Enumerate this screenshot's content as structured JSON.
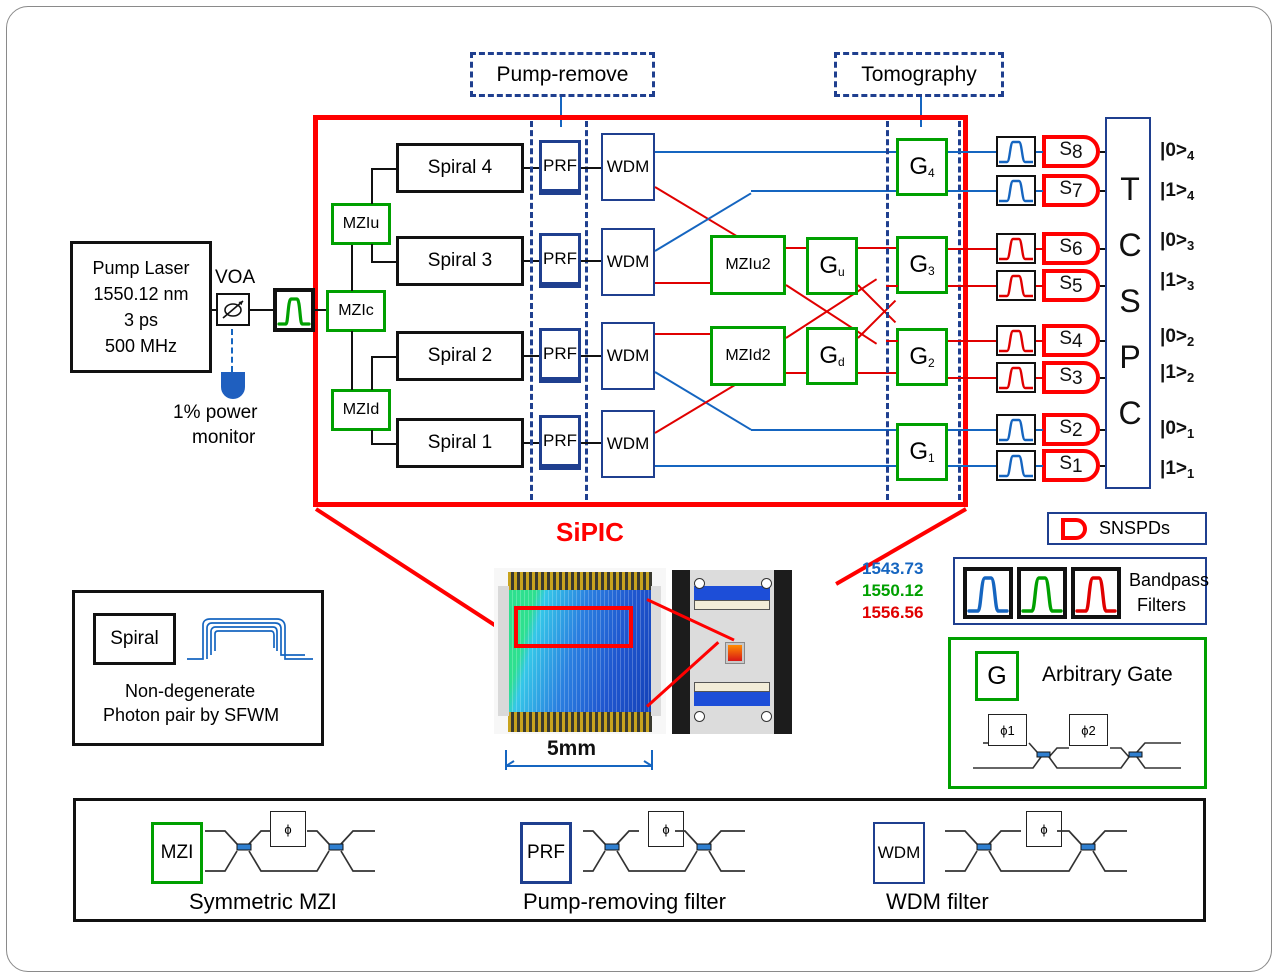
{
  "figure": {
    "title_overlay": "SiPIC",
    "top_callouts": [
      {
        "label": "Pump-remove"
      },
      {
        "label": "Tomography"
      }
    ]
  },
  "pump_source": {
    "lines": [
      "Pump Laser",
      "1550.12 nm",
      "3 ps",
      "500 MHz"
    ],
    "voa_label": "VOA",
    "power_monitor_label": [
      "1% power",
      "monitor"
    ]
  },
  "mzi_tree": [
    {
      "label": "MZIu"
    },
    {
      "label": "MZIc"
    },
    {
      "label": "MZId"
    }
  ],
  "spirals": [
    {
      "label": "Spiral 4"
    },
    {
      "label": "Spiral 3"
    },
    {
      "label": "Spiral 2"
    },
    {
      "label": "Spiral 1"
    }
  ],
  "prf_label": "PRF",
  "wdm_label": "WDM",
  "mzi_second": [
    {
      "label": "MZIu2"
    },
    {
      "label": "MZId2"
    }
  ],
  "gates_center": [
    {
      "label": "G",
      "sub": "u"
    },
    {
      "label": "G",
      "sub": "d"
    }
  ],
  "gates_tomography": [
    {
      "label": "G",
      "sub": "4"
    },
    {
      "label": "G",
      "sub": "3"
    },
    {
      "label": "G",
      "sub": "2"
    },
    {
      "label": "G",
      "sub": "1"
    }
  ],
  "detectors": [
    {
      "label": "S",
      "sub": "8",
      "filter_color": "#1565c0"
    },
    {
      "label": "S",
      "sub": "7",
      "filter_color": "#1565c0"
    },
    {
      "label": "S",
      "sub": "6",
      "filter_color": "#e00000"
    },
    {
      "label": "S",
      "sub": "5",
      "filter_color": "#e00000"
    },
    {
      "label": "S",
      "sub": "4",
      "filter_color": "#e00000"
    },
    {
      "label": "S",
      "sub": "3",
      "filter_color": "#e00000"
    },
    {
      "label": "S",
      "sub": "2",
      "filter_color": "#1565c0"
    },
    {
      "label": "S",
      "sub": "1",
      "filter_color": "#1565c0"
    }
  ],
  "tcspc": {
    "letters": [
      "T",
      "C",
      "S",
      "P",
      "C"
    ]
  },
  "kets": [
    {
      "state": "|0>",
      "sub": "4"
    },
    {
      "state": "|1>",
      "sub": "4"
    },
    {
      "state": "|0>",
      "sub": "3"
    },
    {
      "state": "|1>",
      "sub": "3"
    },
    {
      "state": "|0>",
      "sub": "2"
    },
    {
      "state": "|1>",
      "sub": "2"
    },
    {
      "state": "|0>",
      "sub": "1"
    },
    {
      "state": "|1>",
      "sub": "1"
    }
  ],
  "wavelengths": [
    {
      "value": "1543.73",
      "color": "#1565c0"
    },
    {
      "value": "1550.12",
      "color": "#00a000"
    },
    {
      "value": "1556.56",
      "color": "#e00000"
    }
  ],
  "legends": {
    "snspd": {
      "label": "SNSPDs"
    },
    "bandpass": {
      "label_line1": "Bandpass",
      "label_line2": "Filters"
    },
    "arbitrary_gate": {
      "box_label": "G",
      "label": "Arbitrary Gate",
      "phi1": "ϕ1",
      "phi2": "ϕ2"
    },
    "spiral": {
      "box_label": "Spiral",
      "caption_line1": "Non-degenerate",
      "caption_line2": "Photon pair by SFWM"
    },
    "bottom": [
      {
        "box_label": "MZI",
        "caption": "Symmetric MZI",
        "box_color": "#00a000",
        "phi": "ϕ"
      },
      {
        "box_label": "PRF",
        "caption": "Pump-removing filter",
        "box_color": "#1f3f8f",
        "phi": "ϕ"
      },
      {
        "box_label": "WDM",
        "caption": "WDM filter",
        "box_color": "#1f3f8f",
        "phi": "ϕ"
      }
    ]
  },
  "chip": {
    "scale_bar_label": "5mm"
  },
  "colors": {
    "red": "#ff0000",
    "blue_wire": "#1565c0",
    "green_box": "#00a000",
    "navy": "#1f3f8f",
    "black": "#111111"
  }
}
